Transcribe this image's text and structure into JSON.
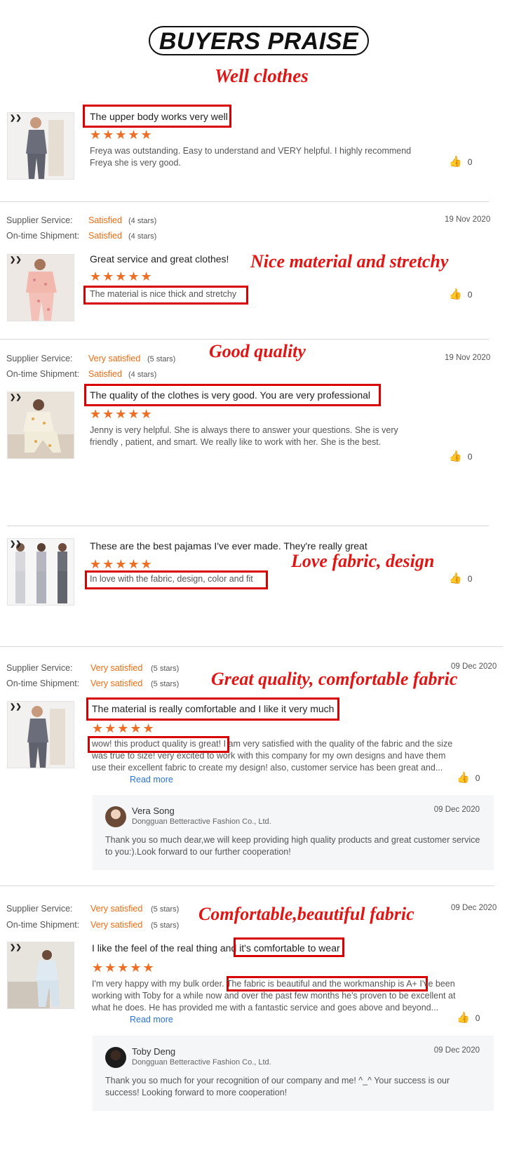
{
  "header": {
    "title": "BUYERS PRAISE"
  },
  "callouts": {
    "c1": "Well clothes",
    "c2": "Nice material and stretchy",
    "c3": "Good quality",
    "c4": "Love fabric, design",
    "c5": "Great quality, comfortable fabric",
    "c6": "Comfortable,beautiful fabric"
  },
  "labels": {
    "supplier_service": "Supplier Service:",
    "ontime_shipment": "On-time Shipment:",
    "read_more": "Read more",
    "stars": "★★★★★"
  },
  "reviews": [
    {
      "title": "The upper body works very well",
      "body": "Freya was outstanding. Easy to understand and VERY helpful. I highly recommend Freya she is very good.",
      "likes": "0"
    },
    {
      "supplier_value": "Satisfied",
      "supplier_stars": "(4 stars)",
      "shipment_value": "Satisfied",
      "shipment_stars": "(4 stars)",
      "date": "19 Nov 2020",
      "title": "Great service and great clothes!",
      "body": "The material is nice thick and stretchy",
      "likes": "0"
    },
    {
      "supplier_value": "Very satisfied",
      "supplier_stars": "(5 stars)",
      "shipment_value": "Satisfied",
      "shipment_stars": "(4 stars)",
      "date": "19 Nov 2020",
      "title": "The quality of the clothes is very good. You are very professional",
      "body": "Jenny is very helpful. She is always there to answer your questions. She is  very friendly , patient, and smart. We really like to work with her. She is the best.",
      "likes": "0"
    },
    {
      "title": "These are the best pajamas I've ever made. They're really great",
      "body": "In love with the fabric, design,  color and fit",
      "likes": "0"
    },
    {
      "supplier_value": "Very satisfied",
      "supplier_stars": "(5 stars)",
      "shipment_value": "Very satisfied",
      "shipment_stars": "(5 stars)",
      "date": "09 Dec 2020",
      "title": "The material is really comfortable and I like it very much",
      "body_highlight": "wow! this product quality is great!",
      "body_rest": "I am very satisfied with the quality of the fabric and the size was true to size! very excited to work with this company for my own designs and have them use their excellent fabric to create my design! also, customer service has been great and...",
      "likes": "0",
      "reply": {
        "name": "Vera Song",
        "company": "Dongguan Betteractive Fashion Co., Ltd.",
        "date": "09 Dec 2020",
        "text": "Thank you so much dear,we will keep providing high quality products and great customer service to you:).Look forward to our further cooperation!"
      }
    },
    {
      "supplier_value": "Very satisfied",
      "supplier_stars": "(5 stars)",
      "shipment_value": "Very satisfied",
      "shipment_stars": "(5 stars)",
      "date": "09 Dec 2020",
      "title_pre": "I like the feel of the real thing and",
      "title_highlight": "it's comfortable to wear",
      "body_pre": "I'm very happy with my bulk order.",
      "body_highlight": "The fabric is beautiful and the workmanship is A+",
      "body_rest": "I've been working with Toby for a while now and over the past few months he's proven to be excellent at what he does. He has provided me with a fantastic service and goes above and beyond...",
      "likes": "0",
      "reply": {
        "name": "Toby Deng",
        "company": "Dongguan Betteractive Fashion Co., Ltd.",
        "date": "09 Dec 2020",
        "text": "Thank you so much for your recognition of our company and me!  ^_^ Your success is our success! Looking forward to more cooperation!"
      }
    }
  ]
}
